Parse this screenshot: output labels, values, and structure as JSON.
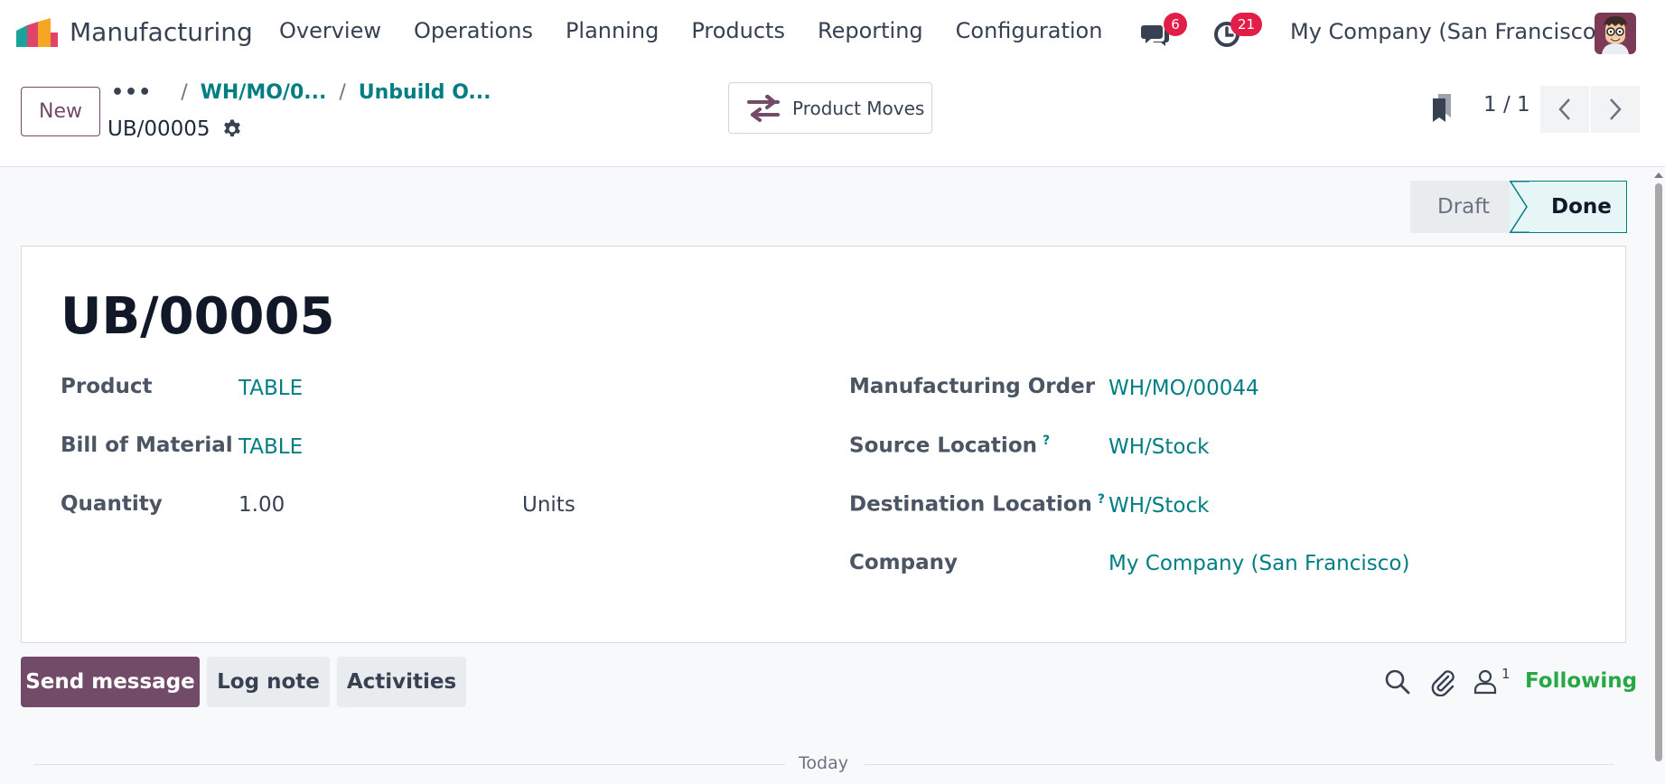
{
  "navbar": {
    "app_name": "Manufacturing",
    "menu": [
      "Overview",
      "Operations",
      "Planning",
      "Products",
      "Reporting",
      "Configuration"
    ],
    "messages_count": "6",
    "activities_count": "21",
    "company": "My Company (San Francisco)"
  },
  "control_panel": {
    "new_label": "New",
    "breadcrumb_dots": "•••",
    "breadcrumb_1": "WH/MO/0...",
    "breadcrumb_2": "Unbuild O...",
    "record_name": "UB/00005",
    "product_moves_label": "Product Moves",
    "pager_value": "1 / 1"
  },
  "status": {
    "stages": [
      "Draft",
      "Done"
    ],
    "current": "Done"
  },
  "form": {
    "title": "UB/00005",
    "product_label": "Product",
    "product_value": "TABLE",
    "bom_label": "Bill of Material",
    "bom_value": "TABLE",
    "quantity_label": "Quantity",
    "quantity_value": "1.00",
    "uom_value": "Units",
    "mo_label": "Manufacturing Order",
    "mo_value": "WH/MO/00044",
    "source_label": "Source Location",
    "source_value": "WH/Stock",
    "dest_label": "Destination Location",
    "dest_value": "WH/Stock",
    "company_label": "Company",
    "company_value": "My Company (San Francisco)",
    "help_mark": "?"
  },
  "chatter": {
    "send_message": "Send message",
    "log_note": "Log note",
    "activities": "Activities",
    "follower_count": "1",
    "following_label": "Following",
    "today_label": "Today"
  },
  "colors": {
    "brand": "#714b67",
    "link": "#017e84",
    "badge": "#e11d48",
    "following": "#28a745"
  },
  "icons": [
    "app-logo-icon",
    "messages-icon",
    "activity-clock-icon",
    "gear-icon",
    "transfer-arrows-icon",
    "bookmark-icon",
    "chevron-left-icon",
    "chevron-right-icon",
    "search-icon",
    "paperclip-icon",
    "followers-icon"
  ]
}
